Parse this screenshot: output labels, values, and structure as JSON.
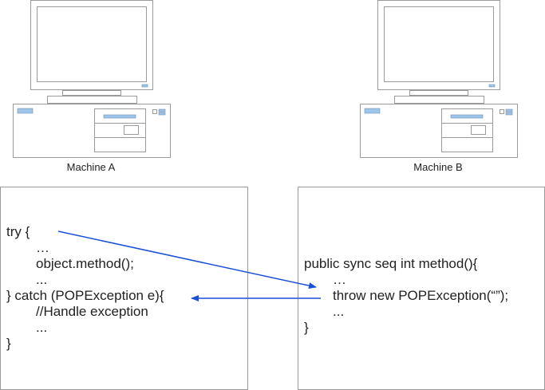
{
  "machines": [
    {
      "label": "Machine A"
    },
    {
      "label": "Machine B"
    }
  ],
  "code_a": {
    "lines": [
      "try {",
      "…",
      "object.method();",
      "...",
      "} catch (POPException e){",
      "//Handle exception",
      "...",
      "}"
    ]
  },
  "code_b": {
    "lines": [
      "public sync seq int method(){",
      "…",
      "throw new POPException(“”);",
      "...",
      "}"
    ]
  },
  "colors": {
    "arrow": "#1a4fd8",
    "screen_accent": "#9ec5ea",
    "outline": "#9a9a9a"
  }
}
